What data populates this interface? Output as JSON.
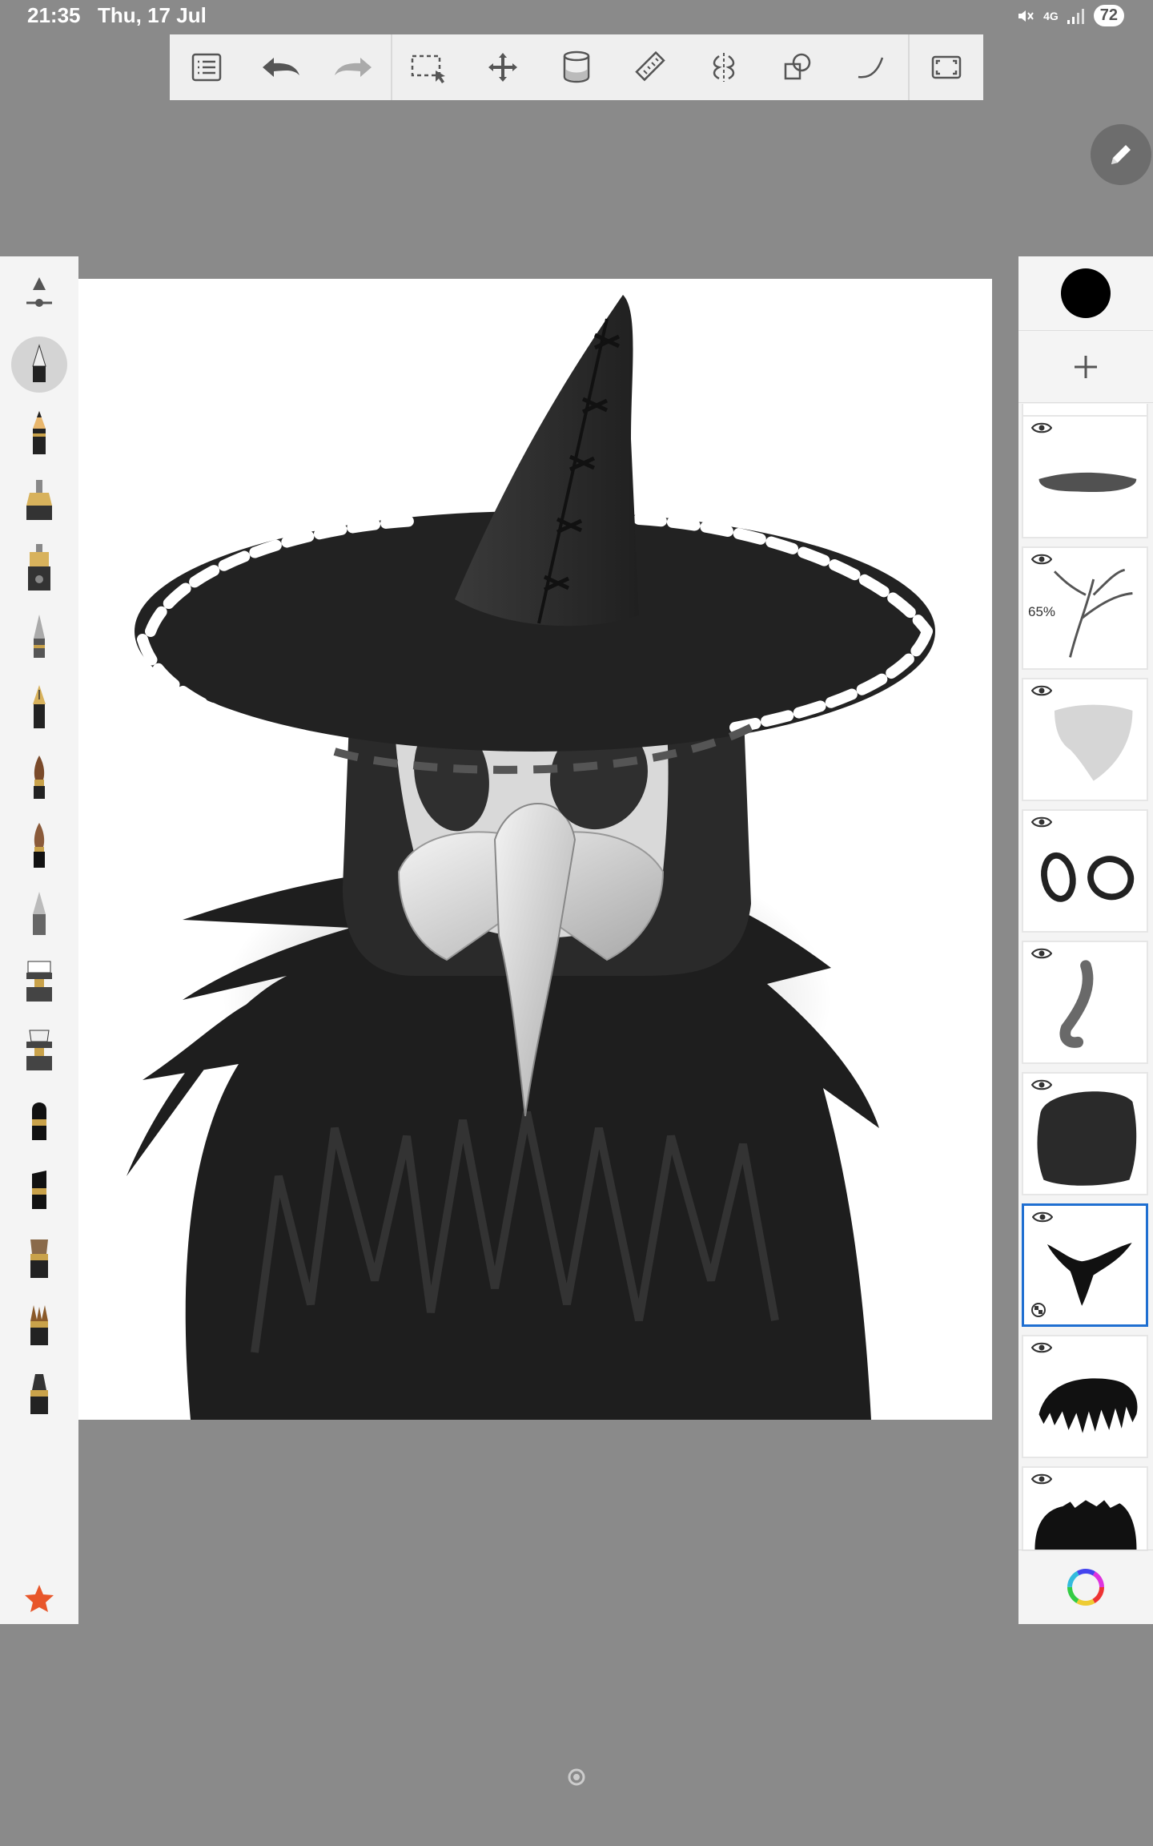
{
  "status_bar": {
    "time": "21:35",
    "date": "Thu, 17 Jul",
    "network": "4G",
    "battery": "72"
  },
  "toolbar": {
    "buttons": [
      {
        "name": "list-icon"
      },
      {
        "name": "undo-icon"
      },
      {
        "name": "redo-icon"
      },
      {
        "name": "selection-icon"
      },
      {
        "name": "transform-icon"
      },
      {
        "name": "fill-icon"
      },
      {
        "name": "ruler-icon"
      },
      {
        "name": "symmetry-icon"
      },
      {
        "name": "shapes-icon"
      },
      {
        "name": "curve-icon"
      },
      {
        "name": "fullscreen-icon"
      }
    ]
  },
  "brushes": {
    "items": [
      "brush-settings",
      "airbrush",
      "pencil",
      "inking-pen",
      "ballpoint-pen",
      "technical-pen",
      "fountain-pen",
      "paintbrush",
      "marker-brush",
      "chisel",
      "eraser",
      "hard-eraser",
      "felt-tip",
      "marker",
      "flat-brush",
      "bristle-brush",
      "round-brush"
    ],
    "favorites_icon": "star-icon"
  },
  "layers": {
    "current_color": "#000000",
    "items": [
      {
        "label": "",
        "opacity_label": "",
        "selected": false,
        "visible": true
      },
      {
        "label": "",
        "opacity_label": "65%",
        "selected": false,
        "visible": true
      },
      {
        "label": "",
        "opacity_label": "",
        "selected": false,
        "visible": true
      },
      {
        "label": "",
        "opacity_label": "",
        "selected": false,
        "visible": true
      },
      {
        "label": "",
        "opacity_label": "",
        "selected": false,
        "visible": true
      },
      {
        "label": "",
        "opacity_label": "",
        "selected": false,
        "visible": true
      },
      {
        "label": "",
        "opacity_label": "",
        "selected": true,
        "visible": true
      },
      {
        "label": "",
        "opacity_label": "",
        "selected": false,
        "visible": true
      },
      {
        "label": "",
        "opacity_label": "",
        "selected": false,
        "visible": true
      }
    ]
  },
  "colors": {
    "accent": "#1f6fd1",
    "favorite_star": "#e8562a"
  }
}
